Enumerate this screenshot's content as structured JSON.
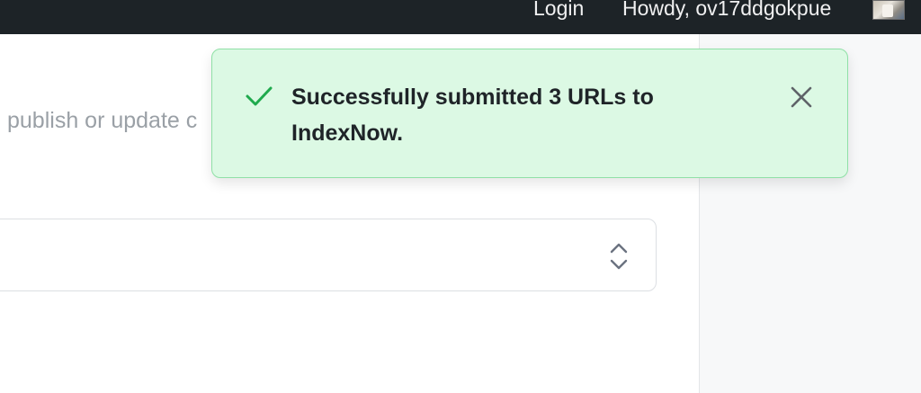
{
  "admin_bar": {
    "login_label": "Login",
    "howdy_label": "Howdy, ov17ddgokpue",
    "background": "#1d2327"
  },
  "main": {
    "description_text": "publish or update c",
    "select_value": ""
  },
  "toast": {
    "message": "Successfully submitted 3 URLs to IndexNow.",
    "status": "success",
    "background": "#dcf9e4",
    "border": "#8fe0a6",
    "accent": "#1faa4d",
    "icons": {
      "status": "check-icon",
      "dismiss": "close-icon"
    }
  }
}
